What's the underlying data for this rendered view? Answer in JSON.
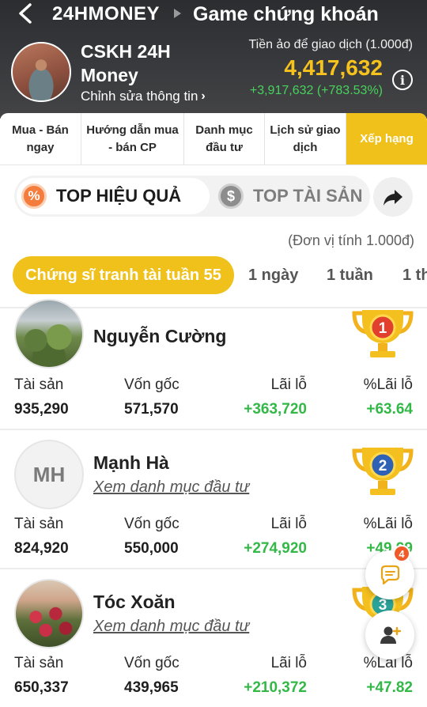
{
  "header": {
    "brand": "24HMONEY",
    "title": "Game chứng khoán",
    "user_name": "CSKH 24H Money",
    "edit_profile": "Chỉnh sửa thông tin",
    "vcash_label": "Tiền ảo để giao dịch (1.000đ)",
    "vcash_value": "4,417,632",
    "vcash_change": "+3,917,632 (+783.53%)",
    "info_glyph": "i"
  },
  "tabs": [
    {
      "label": "Mua - Bán ngay"
    },
    {
      "label": "Hướng dẫn mua - bán CP"
    },
    {
      "label": "Danh mục đầu tư"
    },
    {
      "label": "Lịch sử giao dịch"
    },
    {
      "label": "Xếp hạng",
      "active": true
    }
  ],
  "toggle": {
    "active_label": "TOP HIỆU QUẢ",
    "active_glyph": "%",
    "inactive_label": "TOP TÀI SẢN",
    "inactive_glyph": "$"
  },
  "unit_note": "(Đơn vị tính 1.000đ)",
  "filters": [
    {
      "label": "Chứng sĩ tranh tài tuần 55",
      "active": true
    },
    {
      "label": "1 ngày"
    },
    {
      "label": "1 tuần"
    },
    {
      "label": "1 th"
    }
  ],
  "col_labels": {
    "assets": "Tài sản",
    "capital": "Vốn gốc",
    "profit": "Lãi lỗ",
    "profit_pct": "%Lãi lỗ"
  },
  "rankings": [
    {
      "rank": "1",
      "name": "Nguyễn Cường",
      "assets": "935,290",
      "capital": "571,570",
      "profit": "+363,720",
      "profit_pct": "+63.64"
    },
    {
      "rank": "2",
      "name": "Mạnh Hà",
      "initials": "MH",
      "link": "Xem danh mục đầu tư",
      "assets": "824,920",
      "capital": "550,000",
      "profit": "+274,920",
      "profit_pct": "+49.99"
    },
    {
      "rank": "3",
      "name": "Tóc Xoăn",
      "link": "Xem danh mục đầu tư",
      "assets": "650,337",
      "capital": "439,965",
      "profit": "+210,372",
      "profit_pct": "+47.82"
    }
  ],
  "chat_badge": "4",
  "colors": {
    "accent": "#f0c11a",
    "positive": "#33b847",
    "header_bg": "#333437",
    "gold": "#f6c21d"
  }
}
